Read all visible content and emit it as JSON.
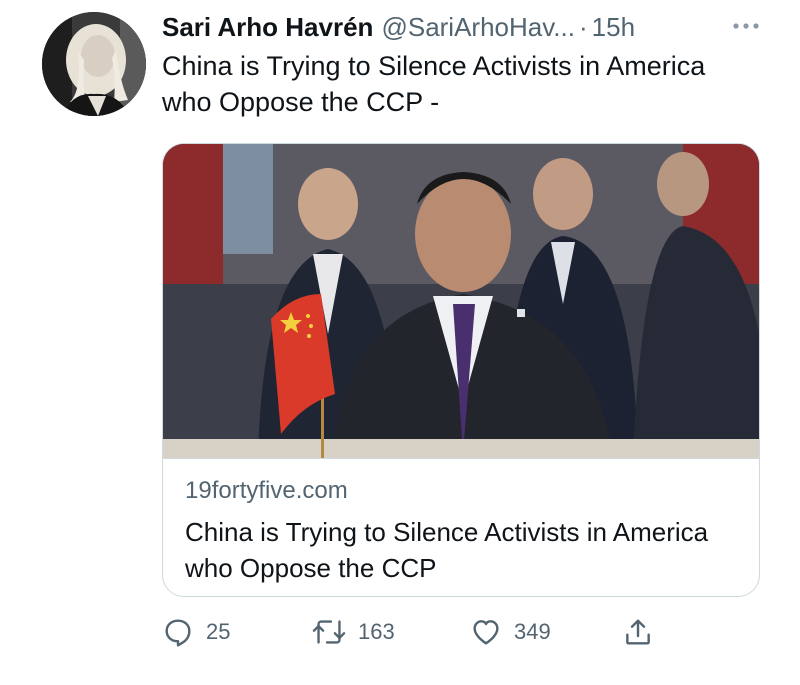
{
  "tweet": {
    "author_name": "Sari Arho Havrén",
    "handle": "@SariArhoHav...",
    "separator": "·",
    "time": "15h",
    "more_icon": "ellipsis-icon",
    "text": "China is Trying to Silence Activists in America who Oppose the CCP -"
  },
  "card": {
    "domain": "19fortyfive.com",
    "title": "China is Trying to Silence Activists in America who Oppose the CCP"
  },
  "actions": {
    "reply": {
      "icon": "reply-icon",
      "count": "25"
    },
    "retweet": {
      "icon": "retweet-icon",
      "count": "163"
    },
    "like": {
      "icon": "heart-icon",
      "count": "349"
    },
    "share": {
      "icon": "share-icon"
    }
  },
  "colors": {
    "text_primary": "#0f1419",
    "text_secondary": "#536471",
    "border": "#cfd9de"
  }
}
